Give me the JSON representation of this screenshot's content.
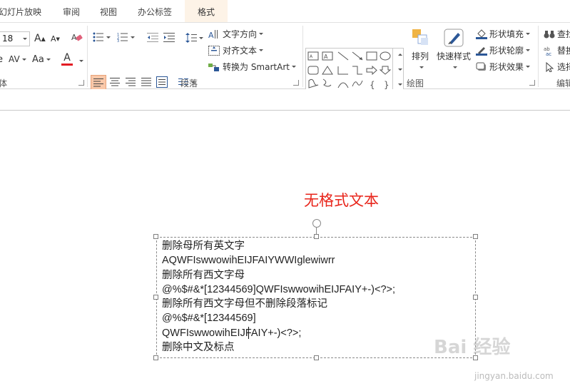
{
  "tabs": [
    {
      "label": "幻灯片放映"
    },
    {
      "label": "审阅"
    },
    {
      "label": "视图"
    },
    {
      "label": "办公标签"
    },
    {
      "label": "格式",
      "active": true
    }
  ],
  "ribbon": {
    "font": {
      "group_label": "体",
      "font_size": "18",
      "grow_label": "A",
      "shrink_label": "A",
      "spacing_label": "AV",
      "case_label": "Aa",
      "color_label": "A",
      "font_color": "#e31b23",
      "shadow_label": "e"
    },
    "paragraph": {
      "group_label": "段落",
      "text_direction": "文字方向",
      "align_text": "对齐文本",
      "convert_smartart": "转换为 SmartArt"
    },
    "drawing": {
      "group_label": "绘图",
      "arrange": "排列",
      "quick_styles": "快速样式",
      "shape_fill": "形状填充",
      "shape_outline": "形状轮廓",
      "shape_effects": "形状效果"
    },
    "editing": {
      "group_label": "编辑",
      "find": "查找",
      "replace": "替换",
      "select": "选择"
    }
  },
  "document": {
    "heading": "无格式文本",
    "heading_color": "#e8251b",
    "textbox_lines": [
      "删除母所有英文字",
      "AQWFIswwowihEIJFAIYWWIglewiwrr",
      "删除所有西文字母",
      "@%$#&*[12344569]QWFIswwowihEIJFAIY+-)<?>;",
      "删除所有西文字母但不删除段落标记",
      "@%$#&*[12344569]",
      "QWFIswwowihEIJFAIY+-)<?>;",
      "删除中文及标点"
    ]
  },
  "watermark": {
    "text": "Bai 经验",
    "url": "jingyan.baidu.com"
  },
  "colors": {
    "active_tab_bg": "#fdf3e7",
    "selected_align_bg": "#f9c8a9"
  },
  "icons": [
    "bold-a-icon",
    "eraser-icon",
    "bullets-icon",
    "numbering-icon",
    "indent-icon",
    "line-spacing-icon",
    "text-direction-icon",
    "align-text-icon",
    "smartart-icon",
    "arrange-icon",
    "quick-styles-icon",
    "paint-bucket-icon",
    "pen-icon",
    "effects-icon",
    "binoculars-icon",
    "replace-icon",
    "cursor-icon",
    "rotate-handle-icon"
  ]
}
